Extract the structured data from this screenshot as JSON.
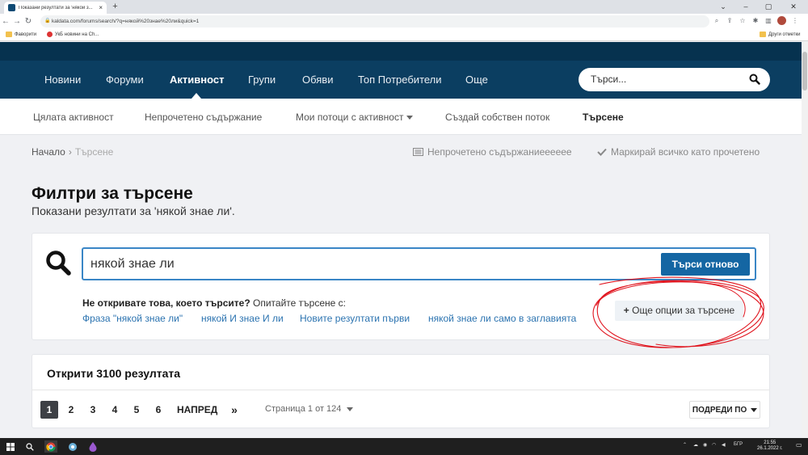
{
  "browser": {
    "tab_title": "Показани резултати за 'някой з...",
    "url": "kaldata.com/forums/search/?q=някой%20знае%20ли&quick=1",
    "bookmarks": [
      "Фаворити",
      "УкБ новини на Ch..."
    ],
    "other_bookmarks": "Други отметки"
  },
  "nav": {
    "items": [
      "Новини",
      "Форуми",
      "Активност",
      "Групи",
      "Обяви",
      "Топ Потребители",
      "Още"
    ],
    "active": "Активност",
    "search_placeholder": "Търси..."
  },
  "subnav": {
    "items": [
      "Цялата активност",
      "Непрочетено съдържание",
      "Мои потоци с активност",
      "Създай собствен поток",
      "Търсене"
    ]
  },
  "breadcrumb": {
    "home": "Начало",
    "current": "Търсене",
    "unread": "Непрочетено съдържаниееееее",
    "mark_read": "Маркирай всичко като прочетено"
  },
  "page": {
    "title": "Филтри за търсене",
    "subtitle": "Показани резултати за 'някой знае ли'."
  },
  "search": {
    "query": "някой знае ли",
    "button": "Търси отново",
    "not_found_bold": "Не откривате това, което търсите?",
    "not_found_rest": "Опитайте търсене с:",
    "suggestions": [
      "Фраза \"някой знае ли\"",
      "някой И знае И ли",
      "Новите резултати първи",
      "някой знае ли само в заглавията"
    ],
    "more_options": "Още опции за търсене"
  },
  "results": {
    "title": "Открити 3100 резултата",
    "pages": [
      "1",
      "2",
      "3",
      "4",
      "5",
      "6"
    ],
    "current_page": "1",
    "next": "НАПРЕД",
    "last": "»",
    "page_info": "Страница 1 от 124",
    "sort": "ПОДРЕДИ ПО"
  },
  "taskbar": {
    "lang": "БГР",
    "time": "21:55",
    "date": "26.1.2022 г."
  },
  "colors": {
    "nav_bg": "#0b3e61",
    "accent": "#1466a3",
    "link": "#2b73b0",
    "annotation": "#e0141e"
  }
}
